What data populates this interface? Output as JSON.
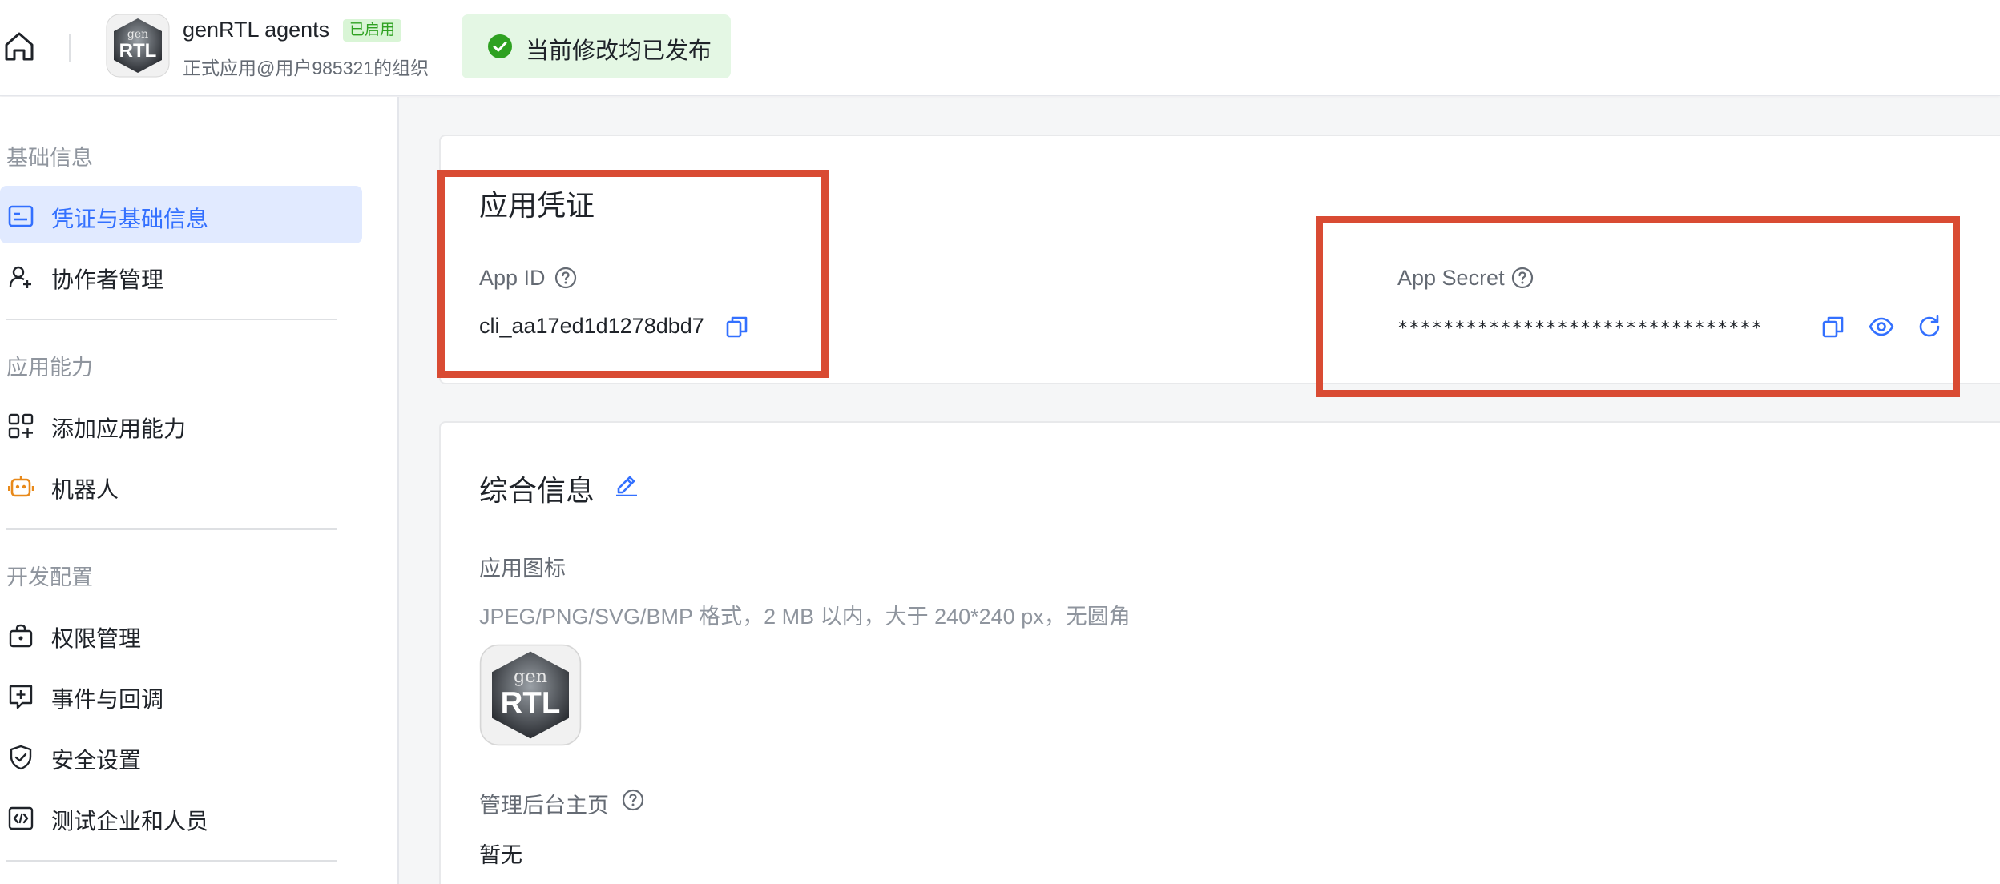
{
  "header": {
    "app_name": "genRTL agents",
    "status": "已启用",
    "org": "正式应用@用户985321的组织",
    "publish_message": "当前修改均已发布",
    "logo_text_top": "gen",
    "logo_text_main": "RTL"
  },
  "sidebar": {
    "sections": [
      {
        "title": "基础信息",
        "items": [
          {
            "label": "凭证与基础信息",
            "icon": "id-card-icon",
            "active": true
          },
          {
            "label": "协作者管理",
            "icon": "user-add-icon",
            "active": false
          }
        ]
      },
      {
        "title": "应用能力",
        "items": [
          {
            "label": "添加应用能力",
            "icon": "apps-add-icon",
            "active": false
          },
          {
            "label": "机器人",
            "icon": "robot-icon",
            "active": false
          }
        ]
      },
      {
        "title": "开发配置",
        "items": [
          {
            "label": "权限管理",
            "icon": "lock-bag-icon",
            "active": false
          },
          {
            "label": "事件与回调",
            "icon": "event-plus-icon",
            "active": false
          },
          {
            "label": "安全设置",
            "icon": "shield-check-icon",
            "active": false
          },
          {
            "label": "测试企业和人员",
            "icon": "code-box-icon",
            "active": false
          }
        ]
      }
    ]
  },
  "credentials": {
    "title": "应用凭证",
    "app_id_label": "App ID",
    "app_id_value": "cli_aa17ed1d1278dbd7",
    "app_secret_label": "App Secret",
    "app_secret_value": "********************************"
  },
  "general": {
    "title": "综合信息",
    "icon_label": "应用图标",
    "icon_hint": "JPEG/PNG/SVG/BMP 格式，2 MB 以内，大于 240*240 px，无圆角",
    "admin_home_label": "管理后台主页",
    "admin_home_value": "暂无"
  },
  "colors": {
    "accent": "#3370ff",
    "highlight_box": "#d94b33",
    "success": "#2ea121",
    "robot_icon": "#e8891a"
  }
}
